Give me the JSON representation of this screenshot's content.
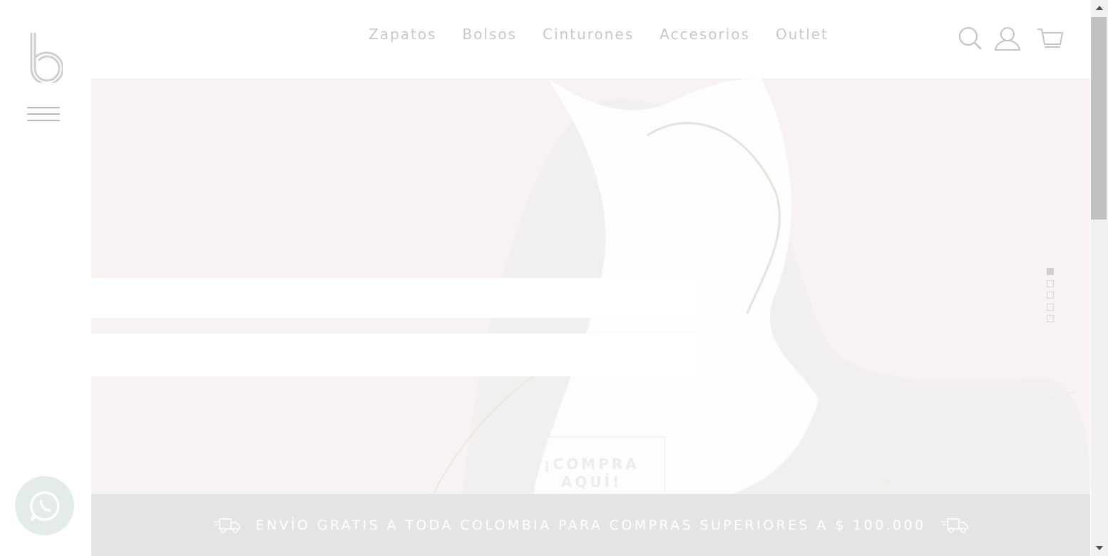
{
  "nav": {
    "items": [
      "Zapatos",
      "Bolsos",
      "Cinturones",
      "Accesorios",
      "Outlet"
    ]
  },
  "header_icons": [
    "search-icon",
    "user-icon",
    "cart-icon"
  ],
  "hero": {
    "cta_line1": "¡COMPRA",
    "cta_line2": "AQUÍ!",
    "slides_total": 5,
    "active_slide": 1
  },
  "banner": {
    "text": "ENVÍO GRATIS A TODA COLOMBIA PARA COMPRAS SUPERIORES A $ 100.000"
  },
  "colors": {
    "hero_bg": "#f8f3f2",
    "banner_bg": "#e4e4e4",
    "nav_text": "#c8c8c8",
    "whatsapp_bg": "#e3ecea"
  }
}
